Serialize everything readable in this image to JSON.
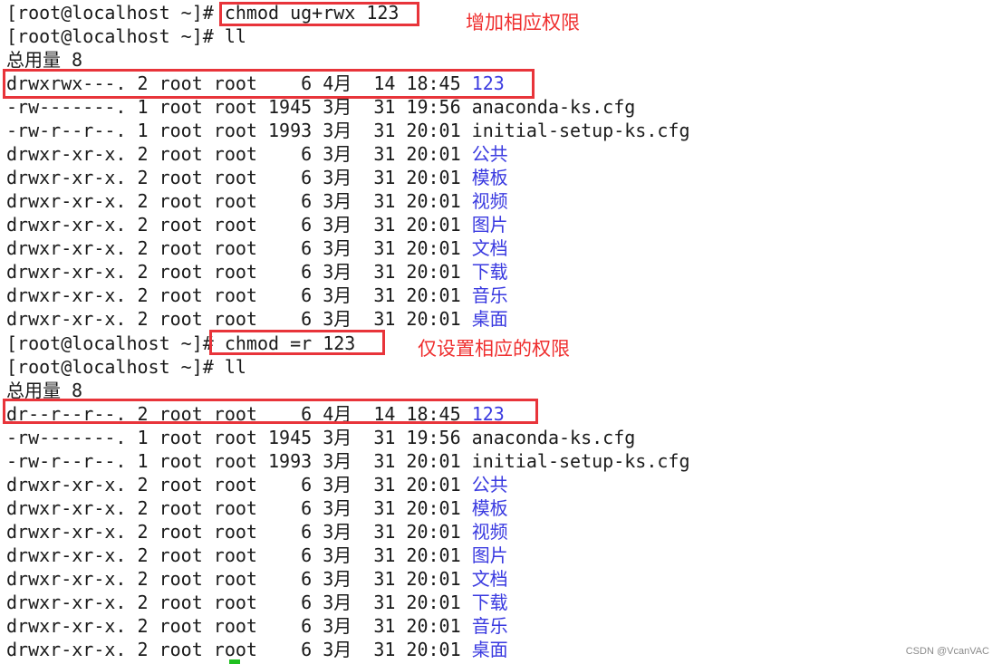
{
  "terminal": {
    "lines": [
      {
        "text": "[root@localhost ~]# chmod ug+rwx 123",
        "dir": ""
      },
      {
        "text": "[root@localhost ~]# ll",
        "dir": ""
      },
      {
        "text": "总用量 8",
        "dir": ""
      },
      {
        "text": "drwxrwx---. 2 root root    6 4月  14 18:45 ",
        "dir": "123"
      },
      {
        "text": "-rw-------. 1 root root 1945 3月  31 19:56 anaconda-ks.cfg",
        "dir": ""
      },
      {
        "text": "-rw-r--r--. 1 root root 1993 3月  31 20:01 initial-setup-ks.cfg",
        "dir": ""
      },
      {
        "text": "drwxr-xr-x. 2 root root    6 3月  31 20:01 ",
        "dir": "公共"
      },
      {
        "text": "drwxr-xr-x. 2 root root    6 3月  31 20:01 ",
        "dir": "模板"
      },
      {
        "text": "drwxr-xr-x. 2 root root    6 3月  31 20:01 ",
        "dir": "视频"
      },
      {
        "text": "drwxr-xr-x. 2 root root    6 3月  31 20:01 ",
        "dir": "图片"
      },
      {
        "text": "drwxr-xr-x. 2 root root    6 3月  31 20:01 ",
        "dir": "文档"
      },
      {
        "text": "drwxr-xr-x. 2 root root    6 3月  31 20:01 ",
        "dir": "下载"
      },
      {
        "text": "drwxr-xr-x. 2 root root    6 3月  31 20:01 ",
        "dir": "音乐"
      },
      {
        "text": "drwxr-xr-x. 2 root root    6 3月  31 20:01 ",
        "dir": "桌面"
      },
      {
        "text": "[root@localhost ~]# chmod =r 123",
        "dir": ""
      },
      {
        "text": "[root@localhost ~]# ll",
        "dir": ""
      },
      {
        "text": "总用量 8",
        "dir": ""
      },
      {
        "text": "dr--r--r--. 2 root root    6 4月  14 18:45 ",
        "dir": "123"
      },
      {
        "text": "-rw-------. 1 root root 1945 3月  31 19:56 anaconda-ks.cfg",
        "dir": ""
      },
      {
        "text": "-rw-r--r--. 1 root root 1993 3月  31 20:01 initial-setup-ks.cfg",
        "dir": ""
      },
      {
        "text": "drwxr-xr-x. 2 root root    6 3月  31 20:01 ",
        "dir": "公共"
      },
      {
        "text": "drwxr-xr-x. 2 root root    6 3月  31 20:01 ",
        "dir": "模板"
      },
      {
        "text": "drwxr-xr-x. 2 root root    6 3月  31 20:01 ",
        "dir": "视频"
      },
      {
        "text": "drwxr-xr-x. 2 root root    6 3月  31 20:01 ",
        "dir": "图片"
      },
      {
        "text": "drwxr-xr-x. 2 root root    6 3月  31 20:01 ",
        "dir": "文档"
      },
      {
        "text": "drwxr-xr-x. 2 root root    6 3月  31 20:01 ",
        "dir": "下载"
      },
      {
        "text": "drwxr-xr-x. 2 root root    6 3月  31 20:01 ",
        "dir": "音乐"
      },
      {
        "text": "drwxr-xr-x. 2 root root    6 3月  31 20:01 ",
        "dir": "桌面"
      }
    ]
  },
  "annotations": {
    "note1": "增加相应权限",
    "note2": "仅设置相应的权限"
  },
  "watermark": "CSDN @VcanVAC",
  "colors": {
    "background": "#ffffff",
    "text": "#1a1a1a",
    "directory": "#3a3ae0",
    "highlight_box": "#e8343a",
    "annotation": "#ef2e2e"
  }
}
